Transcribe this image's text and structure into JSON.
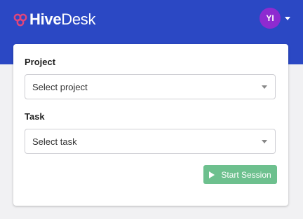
{
  "app": {
    "logo_part1": "Hive",
    "logo_part2": "Desk",
    "brand_color": "#2b48c4",
    "logo_mark_color": "#e0457b"
  },
  "user": {
    "initials": "YI",
    "avatar_color": "#8e2bd0"
  },
  "form": {
    "project_label": "Project",
    "project_value": "Select project",
    "task_label": "Task",
    "task_value": "Select task",
    "start_button_label": "Start Session",
    "start_button_icon": "play-icon",
    "start_button_color": "#6dc08e"
  }
}
